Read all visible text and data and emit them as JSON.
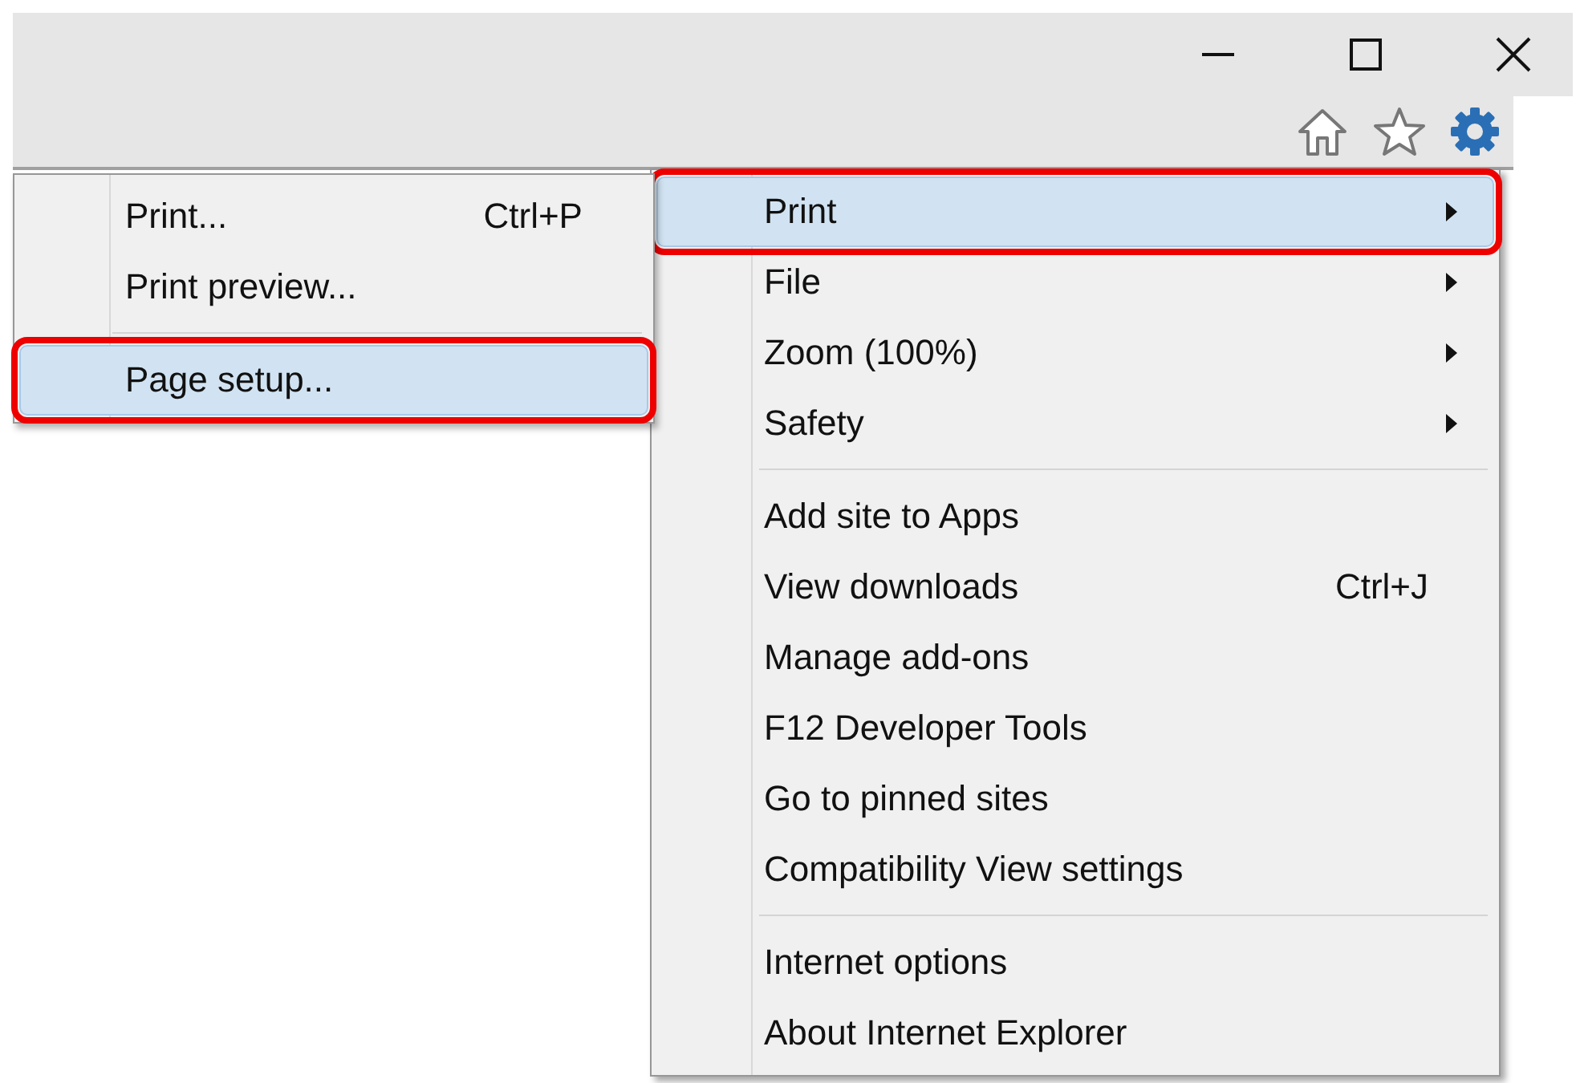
{
  "tools_menu": {
    "items": [
      {
        "kind": "item",
        "label": "Print",
        "submenu": true,
        "selected": true,
        "highlighted": true
      },
      {
        "kind": "item",
        "label": "File",
        "submenu": true,
        "selected": false,
        "highlighted": false
      },
      {
        "kind": "item",
        "label": "Zoom (100%)",
        "submenu": true,
        "selected": false,
        "highlighted": false
      },
      {
        "kind": "item",
        "label": "Safety",
        "submenu": true,
        "selected": false,
        "highlighted": false
      },
      {
        "kind": "separator"
      },
      {
        "kind": "item",
        "label": "Add site to Apps",
        "selected": false,
        "highlighted": false
      },
      {
        "kind": "item",
        "label": "View downloads",
        "shortcut": "Ctrl+J",
        "selected": false,
        "highlighted": false
      },
      {
        "kind": "item",
        "label": "Manage add-ons",
        "selected": false,
        "highlighted": false
      },
      {
        "kind": "item",
        "label": "F12 Developer Tools",
        "selected": false,
        "highlighted": false
      },
      {
        "kind": "item",
        "label": "Go to pinned sites",
        "selected": false,
        "highlighted": false
      },
      {
        "kind": "item",
        "label": "Compatibility View settings",
        "selected": false,
        "highlighted": false
      },
      {
        "kind": "separator"
      },
      {
        "kind": "item",
        "label": "Internet options",
        "selected": false,
        "highlighted": false
      },
      {
        "kind": "item",
        "label": "About Internet Explorer",
        "selected": false,
        "highlighted": false
      }
    ]
  },
  "print_submenu": {
    "items": [
      {
        "kind": "item",
        "label": "Print...",
        "shortcut": "Ctrl+P",
        "selected": false,
        "highlighted": false
      },
      {
        "kind": "item",
        "label": "Print preview...",
        "selected": false,
        "highlighted": false
      },
      {
        "kind": "separator"
      },
      {
        "kind": "item",
        "label": "Page setup...",
        "selected": true,
        "highlighted": true
      }
    ]
  }
}
